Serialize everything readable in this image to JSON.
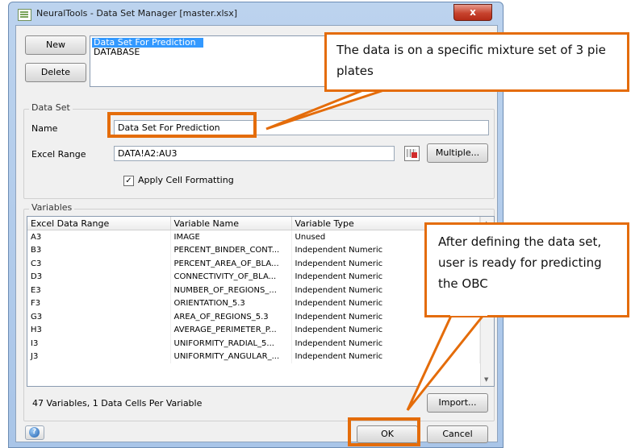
{
  "window": {
    "title": "NeuralTools - Data Set Manager [master.xlsx]",
    "close_glyph": "x"
  },
  "toolbar": {
    "new_label": "New",
    "delete_label": "Delete"
  },
  "datasets": {
    "items": [
      {
        "label": "Data Set For Prediction",
        "selected": true
      },
      {
        "label": "DATABASE",
        "selected": false
      }
    ]
  },
  "dataset_group": {
    "label": "Data Set",
    "name_label": "Name",
    "name_value": "Data Set For Prediction",
    "range_label": "Excel Range",
    "range_value": "DATA!A2:AU3",
    "multiple_label": "Multiple...",
    "apply_label": "Apply Cell Formatting",
    "apply_checked": "✓"
  },
  "variables_group": {
    "label": "Variables",
    "columns": [
      "Excel Data Range",
      "Variable Name",
      "Variable Type"
    ],
    "rows": [
      [
        "A3",
        "IMAGE",
        "Unused"
      ],
      [
        "B3",
        "PERCENT_BINDER_CONT...",
        "Independent Numeric"
      ],
      [
        "C3",
        "PERCENT_AREA_OF_BLA...",
        "Independent Numeric"
      ],
      [
        "D3",
        "CONNECTIVITY_OF_BLA...",
        "Independent Numeric"
      ],
      [
        "E3",
        "NUMBER_OF_REGIONS_...",
        "Independent Numeric"
      ],
      [
        "F3",
        "ORIENTATION_5.3",
        "Independent Numeric"
      ],
      [
        "G3",
        "AREA_OF_REGIONS_5.3",
        "Independent Numeric"
      ],
      [
        "H3",
        "AVERAGE_PERIMETER_P...",
        "Independent Numeric"
      ],
      [
        "I3",
        "UNIFORMITY_RADIAL_5...",
        "Independent Numeric"
      ],
      [
        "J3",
        "UNIFORMITY_ANGULAR_...",
        "Independent Numeric"
      ]
    ],
    "summary": "47 Variables, 1 Data Cells Per Variable",
    "import_label": "Import..."
  },
  "footer": {
    "help_glyph": "?",
    "ok_label": "OK",
    "cancel_label": "Cancel"
  },
  "annotations": {
    "callout_top": "The data is on a specific mixture set of 3 pie plates",
    "callout_right": "After defining the data set, user is ready for predicting the OBC",
    "accent_color": "#e46c0a"
  }
}
